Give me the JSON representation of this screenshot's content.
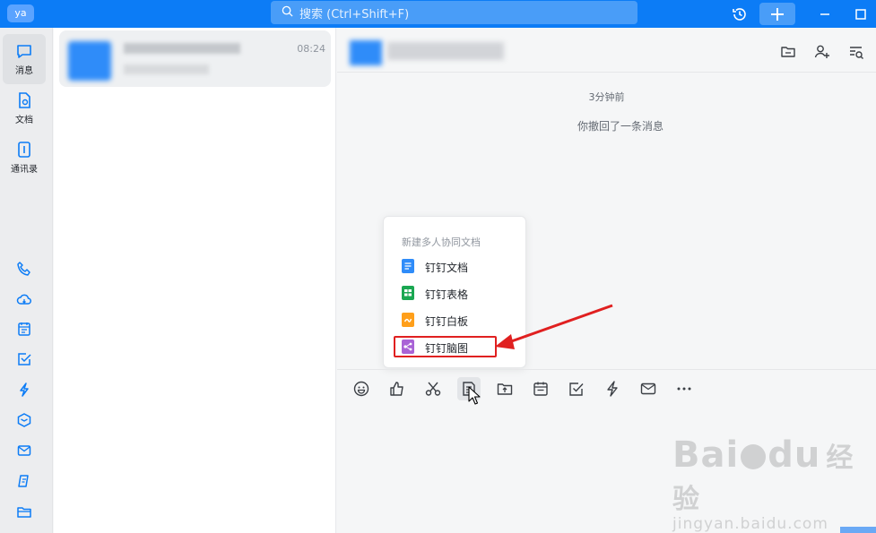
{
  "titlebar": {
    "app_logo": "ya",
    "search_placeholder": "搜索 (Ctrl+Shift+F)",
    "brand_color": "#0c7cf6",
    "icons": [
      "search-icon",
      "history-icon",
      "plus-icon",
      "minimize-icon",
      "maximize-icon"
    ]
  },
  "leftnav": {
    "items": [
      {
        "label": "消息",
        "icon": "chat-bubble-icon",
        "active": true
      },
      {
        "label": "文档",
        "icon": "doc-icon"
      },
      {
        "label": "通讯录",
        "icon": "contacts-icon"
      }
    ],
    "apps": [
      "phone-icon",
      "cloud-icon",
      "calendar-icon",
      "todo-icon",
      "ding-icon",
      "workbench-icon",
      "mail-icon",
      "drive-icon",
      "folder-icon"
    ]
  },
  "convlist": {
    "items": [
      {
        "time": "08:24"
      }
    ]
  },
  "chat": {
    "header_icons": [
      "folder-icon",
      "add-member-icon",
      "search-history-icon"
    ],
    "system_time": "3分钟前",
    "system_recall": "你撤回了一条消息"
  },
  "popup": {
    "title": "新建多人协同文档",
    "items": [
      {
        "label": "钉钉文档",
        "color": "#2f8cf9"
      },
      {
        "label": "钉钉表格",
        "color": "#1aa752"
      },
      {
        "label": "钉钉白板",
        "color": "#ff9f1a"
      },
      {
        "label": "钉钉脑图",
        "color": "#a963d6"
      }
    ]
  },
  "composer": {
    "tools": [
      "emoji-icon",
      "thumbs-up-icon",
      "scissors-icon",
      "new-doc-icon",
      "upload-file-icon",
      "calendar-icon",
      "task-icon",
      "ding-icon",
      "mail-icon",
      "more-icon"
    ]
  },
  "watermark": {
    "logo": "Bai",
    "logo_mid": "du",
    "logo_cn": "经验",
    "url": "jingyan.baidu.com"
  }
}
